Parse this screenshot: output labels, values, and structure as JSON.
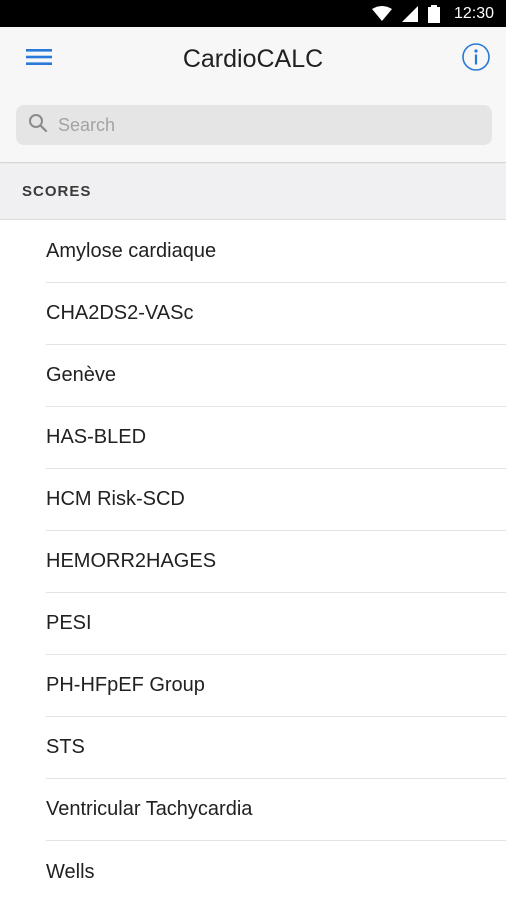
{
  "status_bar": {
    "time": "12:30"
  },
  "app_bar": {
    "title": "CardioCALC"
  },
  "search": {
    "placeholder": "Search",
    "value": ""
  },
  "section": {
    "title": "SCORES"
  },
  "items": [
    {
      "label": "Amylose cardiaque"
    },
    {
      "label": "CHA2DS2-VASc"
    },
    {
      "label": "Genève"
    },
    {
      "label": "HAS-BLED"
    },
    {
      "label": "HCM Risk-SCD"
    },
    {
      "label": "HEMORR2HAGES"
    },
    {
      "label": "PESI"
    },
    {
      "label": "PH-HFpEF Group"
    },
    {
      "label": "STS"
    },
    {
      "label": "Ventricular Tachycardia"
    },
    {
      "label": "Wells"
    }
  ],
  "icons": {
    "menu": "hamburger-menu-icon",
    "info": "info-icon",
    "search": "search-icon",
    "wifi": "wifi-icon",
    "signal": "cell-signal-icon",
    "battery": "battery-icon"
  },
  "colors": {
    "accent": "#2979d9",
    "status_bar": "#000000",
    "app_bar": "#f7f7f7",
    "section_header": "#f0f0f2"
  }
}
